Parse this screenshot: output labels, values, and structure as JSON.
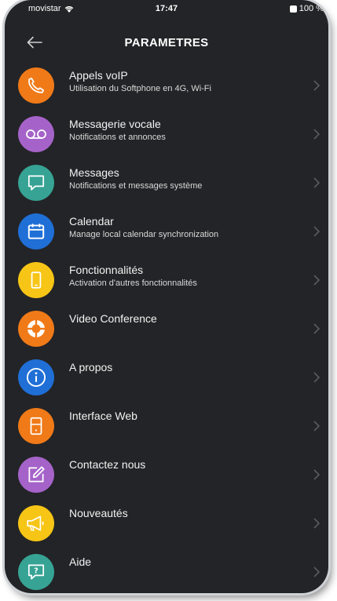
{
  "status_bar": {
    "carrier": "movistar",
    "time": "17:47",
    "battery": "100 %"
  },
  "header": {
    "title": "PARAMETRES"
  },
  "colors": {
    "background": "#232427",
    "orange": "#f07a18",
    "purple": "#a563c9",
    "teal": "#36a394",
    "blue": "#1f6fd6",
    "yellow": "#f6c516"
  },
  "items": [
    {
      "title": "Appels voIP",
      "subtitle": "Utilisation du Softphone en 4G, Wi-Fi",
      "icon": "phone-icon",
      "color": "#f07a18"
    },
    {
      "title": "Messagerie vocale",
      "subtitle": "Notifications et annonces",
      "icon": "voicemail-icon",
      "color": "#a563c9"
    },
    {
      "title": "Messages",
      "subtitle": "Notifications et messages système",
      "icon": "chat-bubble-icon",
      "color": "#36a394"
    },
    {
      "title": "Calendar",
      "subtitle": "Manage local calendar synchronization",
      "icon": "calendar-icon",
      "color": "#1f6fd6"
    },
    {
      "title": "Fonctionnalités",
      "subtitle": "Activation d'autres fonctionnalités",
      "icon": "mobile-device-icon",
      "color": "#f6c516"
    },
    {
      "title": "Video Conference",
      "subtitle": "",
      "icon": "video-conference-icon",
      "color": "#f07a18"
    },
    {
      "title": "A propos",
      "subtitle": "",
      "icon": "info-icon",
      "color": "#1f6fd6"
    },
    {
      "title": "Interface Web",
      "subtitle": "",
      "icon": "web-device-icon",
      "color": "#f07a18"
    },
    {
      "title": "Contactez nous",
      "subtitle": "",
      "icon": "edit-icon",
      "color": "#a563c9"
    },
    {
      "title": "Nouveautés",
      "subtitle": "",
      "icon": "megaphone-icon",
      "color": "#f6c516"
    },
    {
      "title": "Aide",
      "subtitle": "",
      "icon": "help-icon",
      "color": "#36a394"
    }
  ]
}
